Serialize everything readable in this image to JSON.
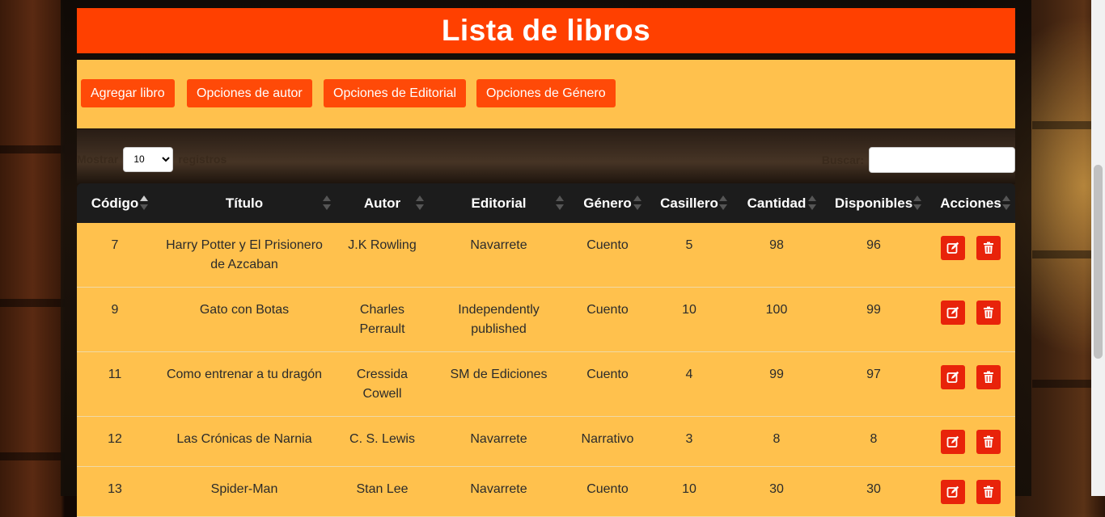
{
  "page_title": "Lista de libros",
  "toolbar": {
    "add_book": "Agregar libro",
    "author_options": "Opciones de autor",
    "publisher_options": "Opciones de Editorial",
    "genre_options": "Opciones de Género"
  },
  "length": {
    "prefix": "Mostrar",
    "value": "10",
    "suffix": "registros"
  },
  "search": {
    "label": "Buscar:",
    "value": ""
  },
  "columns": [
    "Código",
    "Título",
    "Autor",
    "Editorial",
    "Género",
    "Casillero",
    "Cantidad",
    "Disponibles",
    "Acciones"
  ],
  "rows": [
    {
      "codigo": "7",
      "titulo": "Harry Potter y El Prisionero de Azcaban",
      "autor": "J.K Rowling",
      "editorial": "Navarrete",
      "genero": "Cuento",
      "casillero": "5",
      "cantidad": "98",
      "disponibles": "96"
    },
    {
      "codigo": "9",
      "titulo": "Gato con Botas",
      "autor": "Charles Perrault",
      "editorial": "Independently published",
      "genero": "Cuento",
      "casillero": "10",
      "cantidad": "100",
      "disponibles": "99"
    },
    {
      "codigo": "11",
      "titulo": "Como entrenar a tu dragón",
      "autor": "Cressida Cowell",
      "editorial": "SM de Ediciones",
      "genero": "Cuento",
      "casillero": "4",
      "cantidad": "99",
      "disponibles": "97"
    },
    {
      "codigo": "12",
      "titulo": "Las Crónicas de Narnia",
      "autor": "C. S. Lewis",
      "editorial": "Navarrete",
      "genero": "Narrativo",
      "casillero": "3",
      "cantidad": "8",
      "disponibles": "8"
    },
    {
      "codigo": "13",
      "titulo": "Spider-Man",
      "autor": "Stan Lee",
      "editorial": "Navarrete",
      "genero": "Cuento",
      "casillero": "10",
      "cantidad": "30",
      "disponibles": "30"
    }
  ],
  "icons": {
    "edit": "edit-icon",
    "delete": "trash-icon"
  },
  "colors": {
    "header": "#ff4000",
    "toolbar": "#ffc14d",
    "button": "#ff4a08",
    "action": "#e8230a",
    "table_head": "#1c1c1c"
  }
}
